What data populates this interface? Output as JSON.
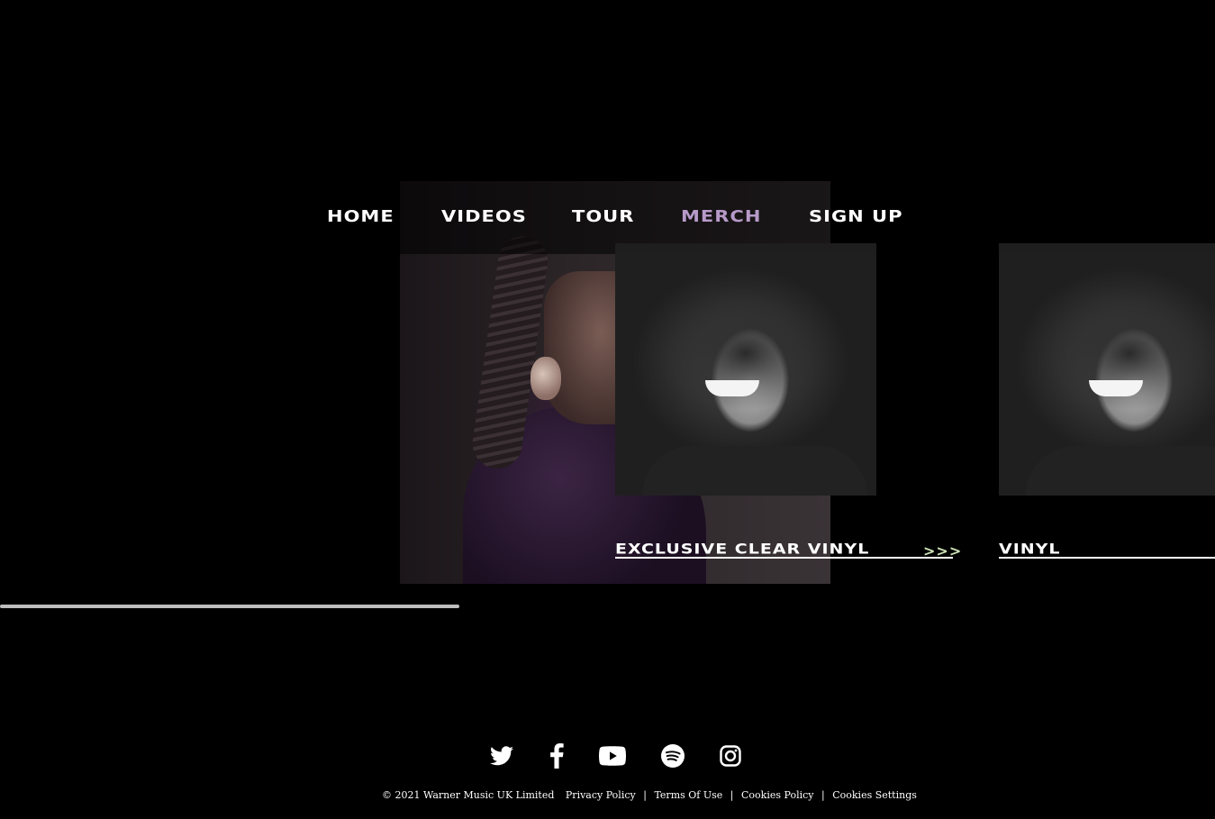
{
  "nav": {
    "items": [
      {
        "label": "HOME",
        "active": false
      },
      {
        "label": "VIDEOS",
        "active": false
      },
      {
        "label": "TOUR",
        "active": false
      },
      {
        "label": "MERCH",
        "active": true
      },
      {
        "label": "SIGN UP",
        "active": false
      }
    ],
    "active_color": "#b79ac9"
  },
  "products": [
    {
      "title": "EXCLUSIVE CLEAR VINYL",
      "arrows": ">>>"
    },
    {
      "title": "VINYL"
    }
  ],
  "social": [
    "twitter-icon",
    "facebook-icon",
    "youtube-icon",
    "spotify-icon",
    "instagram-icon"
  ],
  "footer": {
    "copyright": "© 2021 Warner Music UK Limited",
    "links": [
      "Privacy Policy",
      "Terms Of Use",
      "Cookies Policy",
      "Cookies Settings"
    ],
    "separator": "|"
  }
}
